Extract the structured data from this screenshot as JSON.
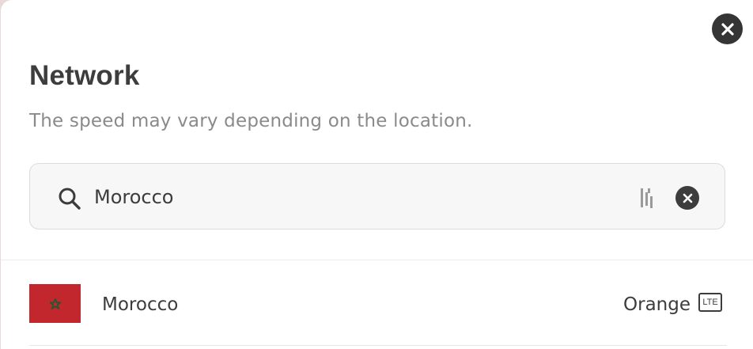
{
  "dialog": {
    "title": "Network",
    "subtitle": "The speed may vary depending on the location.",
    "close_icon": "close-icon"
  },
  "search": {
    "value": "Morocco",
    "search_icon": "search-icon",
    "extension_icon": "password-manager-icon",
    "clear_icon": "clear-icon"
  },
  "results": [
    {
      "country": "Morocco",
      "flag_icon": "morocco-flag-icon",
      "flag_color": "#c1272d",
      "carrier": "Orange",
      "network_type": "LTE"
    }
  ],
  "colors": {
    "background": "#ffffff",
    "text": "#3c3c3c",
    "muted_text": "#8a8a8a",
    "search_bg": "#f7f7f7",
    "close_button": "#353535"
  }
}
